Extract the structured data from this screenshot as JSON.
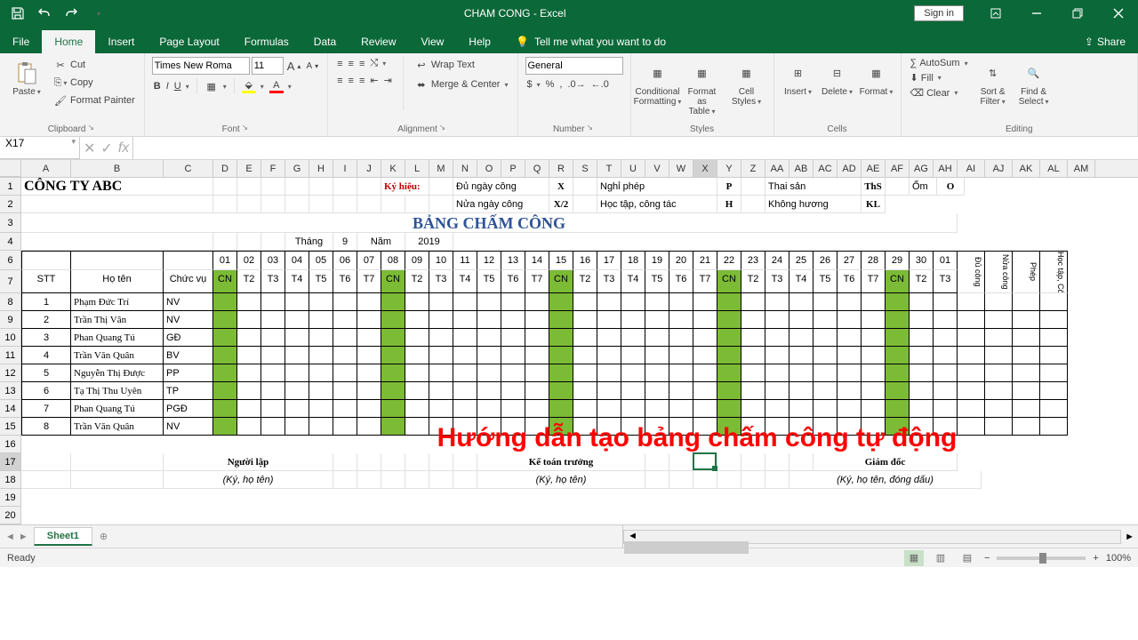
{
  "app": {
    "title": "CHAM CONG - Excel",
    "signin": "Sign in"
  },
  "tabs": {
    "file": "File",
    "home": "Home",
    "insert": "Insert",
    "pagelayout": "Page Layout",
    "formulas": "Formulas",
    "data": "Data",
    "review": "Review",
    "view": "View",
    "help": "Help",
    "tellme": "Tell me what you want to do",
    "share": "Share"
  },
  "ribbon": {
    "clipboard": {
      "label": "Clipboard",
      "paste": "Paste",
      "cut": "Cut",
      "copy": "Copy",
      "painter": "Format Painter"
    },
    "font": {
      "label": "Font",
      "name": "Times New Roma",
      "size": "11",
      "bold": "B",
      "italic": "I",
      "underline": "U"
    },
    "alignment": {
      "label": "Alignment",
      "wrap": "Wrap Text",
      "merge": "Merge & Center"
    },
    "number": {
      "label": "Number",
      "format": "General"
    },
    "styles": {
      "label": "Styles",
      "cond": "Conditional Formatting",
      "table": "Format as Table",
      "cellst": "Cell Styles"
    },
    "cells": {
      "label": "Cells",
      "insert": "Insert",
      "delete": "Delete",
      "format": "Format"
    },
    "editing": {
      "label": "Editing",
      "autosum": "AutoSum",
      "fill": "Fill",
      "clear": "Clear",
      "sort": "Sort & Filter",
      "find": "Find & Select"
    }
  },
  "formulabar": {
    "name": "X17",
    "fx": "fx",
    "value": ""
  },
  "columns": [
    "A",
    "B",
    "C",
    "D",
    "E",
    "F",
    "G",
    "H",
    "I",
    "J",
    "K",
    "L",
    "M",
    "N",
    "O",
    "P",
    "Q",
    "R",
    "S",
    "T",
    "U",
    "V",
    "W",
    "X",
    "Y",
    "Z",
    "AA",
    "AB",
    "AC",
    "AD",
    "AE",
    "AF",
    "AG",
    "AH",
    "AI",
    "AJ",
    "AK",
    "AL",
    "AM"
  ],
  "rows": [
    "1",
    "2",
    "3",
    "4",
    "6",
    "7",
    "8",
    "9",
    "10",
    "11",
    "12",
    "13",
    "14",
    "15",
    "16",
    "17",
    "18",
    "19",
    "20"
  ],
  "content": {
    "company": "CÔNG TY ABC",
    "legend_label": "Ký hiệu:",
    "legend": [
      {
        "k": "Đủ ngày công",
        "v": "X"
      },
      {
        "k": "Nghỉ phép",
        "v": "P"
      },
      {
        "k": "Thai sản",
        "v": "ThS"
      },
      {
        "k": "Ốm",
        "v": "O"
      },
      {
        "k": "Nửa ngày công",
        "v": "X/2"
      },
      {
        "k": "Học tập, công tác",
        "v": "H"
      },
      {
        "k": "Không hương",
        "v": "KL"
      }
    ],
    "title": "BẢNG CHẤM CÔNG",
    "month_label": "Tháng",
    "month": "9",
    "year_label": "Năm",
    "year": "2019",
    "headers": {
      "stt": "STT",
      "hoten": "Họ tên",
      "chucvu": "Chức vụ"
    },
    "days": [
      "01",
      "02",
      "03",
      "04",
      "05",
      "06",
      "07",
      "08",
      "09",
      "10",
      "11",
      "12",
      "13",
      "14",
      "15",
      "16",
      "17",
      "18",
      "19",
      "20",
      "21",
      "22",
      "23",
      "24",
      "25",
      "26",
      "27",
      "28",
      "29",
      "30",
      "01"
    ],
    "wd": [
      "CN",
      "T2",
      "T3",
      "T4",
      "T5",
      "T6",
      "T7",
      "CN",
      "T2",
      "T3",
      "T4",
      "T5",
      "T6",
      "T7",
      "CN",
      "T2",
      "T3",
      "T4",
      "T5",
      "T6",
      "T7",
      "CN",
      "T2",
      "T3",
      "T4",
      "T5",
      "T6",
      "T7",
      "CN",
      "T2",
      "T3"
    ],
    "sumcols": [
      "Đủ công",
      "Nửa công",
      "Phép",
      "Học tập, Công tác"
    ],
    "employees": [
      {
        "stt": "1",
        "name": "Phạm Đức Trí",
        "role": "NV"
      },
      {
        "stt": "2",
        "name": "Trần Thị Vân",
        "role": "NV"
      },
      {
        "stt": "3",
        "name": "Phan Quang Tú",
        "role": "GĐ"
      },
      {
        "stt": "4",
        "name": "Trần Văn Quân",
        "role": "BV"
      },
      {
        "stt": "5",
        "name": "Nguyễn Thị Được",
        "role": "PP"
      },
      {
        "stt": "6",
        "name": "Tạ Thị Thu Uyên",
        "role": "TP"
      },
      {
        "stt": "7",
        "name": "Phan Quang Tú",
        "role": "PGĐ"
      },
      {
        "stt": "8",
        "name": "Trần Văn Quân",
        "role": "NV"
      }
    ],
    "sig": [
      {
        "t": "Người lập",
        "s": "(Ký, họ tên)"
      },
      {
        "t": "Kế toán trưởng",
        "s": "(Ký, họ tên)"
      },
      {
        "t": "Giám đốc",
        "s": "(Ký, họ tên, đóng dấu)"
      }
    ],
    "overlay": "Hướng dẫn tạo bảng chấm công tự động"
  },
  "sheettab": "Sheet1",
  "status": {
    "ready": "Ready",
    "zoom": "100%"
  }
}
